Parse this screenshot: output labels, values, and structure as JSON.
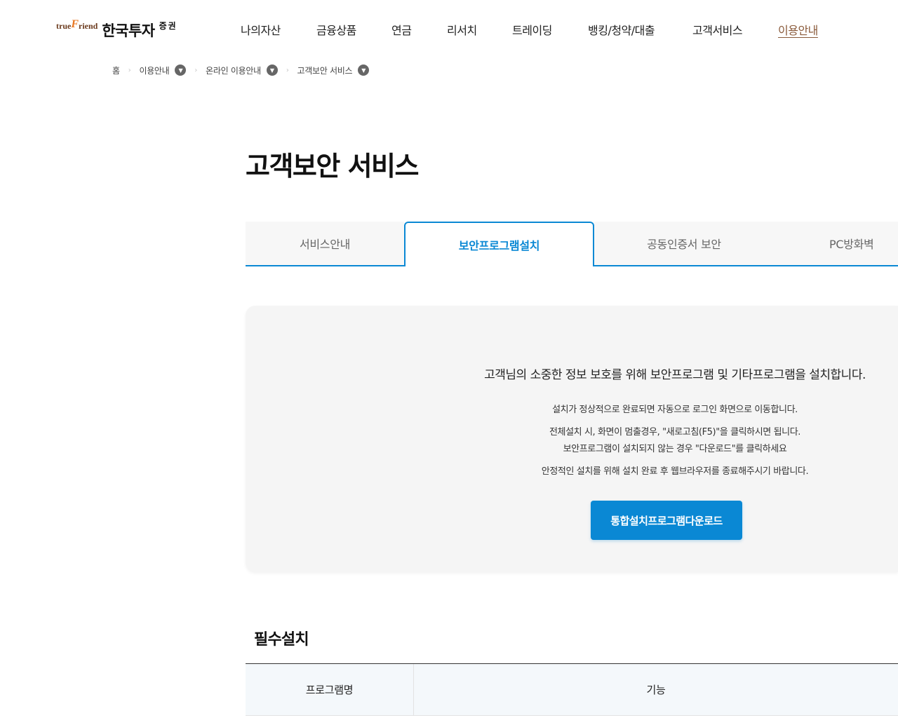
{
  "header": {
    "logo": {
      "true": "true",
      "f": "F",
      "friend": "riend",
      "name": "한국투자",
      "suffix": "증권"
    },
    "nav": [
      {
        "label": "나의자산"
      },
      {
        "label": "금융상품"
      },
      {
        "label": "연금"
      },
      {
        "label": "리서치"
      },
      {
        "label": "트레이딩"
      },
      {
        "label": "뱅킹/청약/대출"
      },
      {
        "label": "고객서비스"
      },
      {
        "label": "이용안내",
        "active": true
      }
    ]
  },
  "breadcrumb": {
    "home": "홈",
    "items": [
      "이용안내",
      "온라인 이용안내",
      "고객보안 서비스"
    ],
    "separator": "›",
    "dropdown_icon": "▼"
  },
  "page_title": "고객보안 서비스",
  "tabs": [
    {
      "label": "서비스안내"
    },
    {
      "label": "보안프로그램설치",
      "active": true
    },
    {
      "label": "공동인증서 보안"
    },
    {
      "label": "PC방화벽"
    }
  ],
  "info": {
    "headline": "고객님의 소중한 정보 보호를 위해 보안프로그램 및 기타프로그램을 설치합니다.",
    "lines": [
      "설치가 정상적으로 완료되면 자동으로 로그인 화면으로 이동합니다.",
      "전체설치 시, 화면이 멈출경우, \"새로고침(F5)\"을 클릭하시면 됩니다.",
      "보안프로그램이 설치되지 않는 경우 \"다운로드\"를 클릭하세요",
      "안정적인 설치를 위해 설치 완료 후 웹브라우저를 종료해주시기 바랍니다."
    ],
    "download_button": "통합설치프로그램다운로드"
  },
  "required_section": {
    "title": "필수설치",
    "columns": [
      "프로그램명",
      "기능"
    ]
  },
  "colors": {
    "accent": "#0a88d4",
    "active_nav": "#8a5a3a",
    "logo_brown": "#6b3a1d",
    "logo_orange": "#e87722",
    "panel_bg": "#f5f5f5"
  }
}
